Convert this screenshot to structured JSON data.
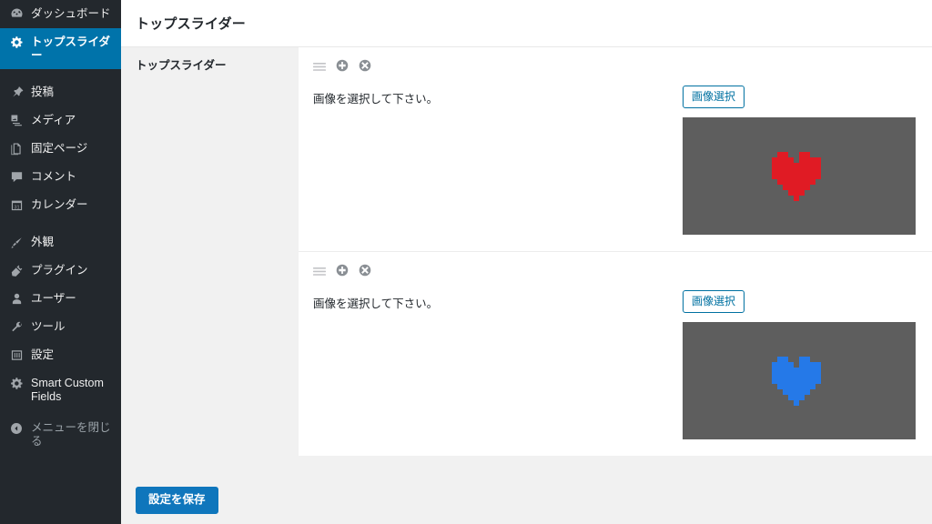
{
  "sidebar": {
    "items": [
      {
        "label": "ダッシュボード",
        "icon": "dashboard-icon",
        "active": false
      },
      {
        "label": "トップスライダー",
        "icon": "gear-icon",
        "active": true
      },
      {
        "label": "投稿",
        "icon": "pin-icon",
        "active": false
      },
      {
        "label": "メディア",
        "icon": "media-icon",
        "active": false
      },
      {
        "label": "固定ページ",
        "icon": "page-icon",
        "active": false
      },
      {
        "label": "コメント",
        "icon": "comment-icon",
        "active": false
      },
      {
        "label": "カレンダー",
        "icon": "calendar-icon",
        "active": false
      },
      {
        "label": "外観",
        "icon": "brush-icon",
        "active": false
      },
      {
        "label": "プラグイン",
        "icon": "plugin-icon",
        "active": false
      },
      {
        "label": "ユーザー",
        "icon": "user-icon",
        "active": false
      },
      {
        "label": "ツール",
        "icon": "wrench-icon",
        "active": false
      },
      {
        "label": "設定",
        "icon": "settings-icon",
        "active": false
      },
      {
        "label": "Smart Custom Fields",
        "icon": "gear-icon",
        "active": false
      },
      {
        "label": "メニューを閉じる",
        "icon": "collapse-arrow-icon",
        "active": false
      }
    ],
    "colors": {
      "background": "#23282d",
      "active_background": "#0073aa",
      "text": "#eeeeee",
      "icon": "#a0a5aa"
    }
  },
  "header": {
    "title": "トップスライダー"
  },
  "form": {
    "field_label": "トップスライダー",
    "rows": [
      {
        "note": "画像を選択して下さい。",
        "select_button": "画像選択",
        "thumb": {
          "background": "#5e5e5e",
          "art": "pixel-heart",
          "color": "#e01b24"
        },
        "tools": {
          "drag": "drag-handle-icon",
          "add": "add-circle-icon",
          "remove": "remove-circle-icon"
        }
      },
      {
        "note": "画像を選択して下さい。",
        "select_button": "画像選択",
        "thumb": {
          "background": "#5e5e5e",
          "art": "pixel-heart",
          "color": "#2579e8"
        },
        "tools": {
          "drag": "drag-handle-icon",
          "add": "add-circle-icon",
          "remove": "remove-circle-icon"
        }
      }
    ],
    "submit_label": "設定を保存",
    "submit_color": "#0f76bc",
    "select_button_color": "#0071a1"
  }
}
